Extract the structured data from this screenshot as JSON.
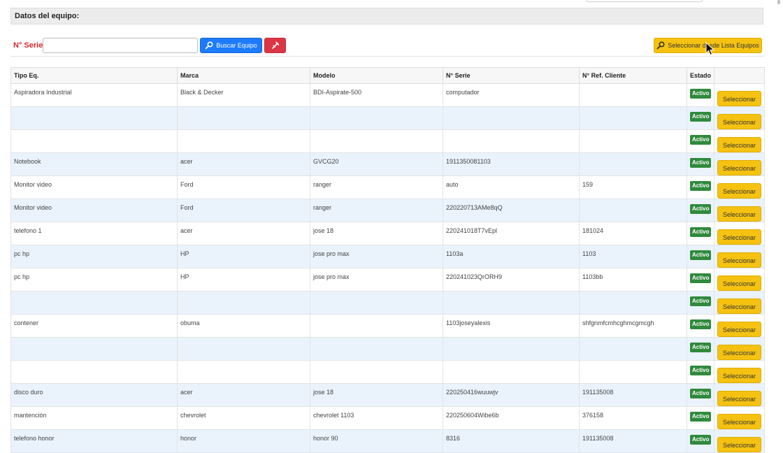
{
  "section": {
    "title": "Datos del equipo:"
  },
  "search": {
    "serial_label": "N° Serie:",
    "serial_value": "",
    "search_button": "Buscar Equipo",
    "select_from_list_button": "Seleccionar desde Lista Equipos"
  },
  "table": {
    "headers": [
      "Tipo Eq.",
      "Marca",
      "Modelo",
      "N° Serie",
      "N° Ref. Cliente",
      "Estado",
      ""
    ],
    "rows": [
      {
        "tipo": "Aspiradora Industrial",
        "marca": "Black & Decker",
        "modelo": "BDI-Aspirate-500",
        "serie": "computador",
        "ref": "",
        "estado": "Activo",
        "accion": "Seleccionar"
      },
      {
        "tipo": "",
        "marca": "",
        "modelo": "",
        "serie": "",
        "ref": "",
        "estado": "Activo",
        "accion": "Seleccionar"
      },
      {
        "tipo": "",
        "marca": "",
        "modelo": "",
        "serie": "",
        "ref": "",
        "estado": "Activo",
        "accion": "Seleccionar"
      },
      {
        "tipo": "Notebook",
        "marca": "acer",
        "modelo": "GVCG20",
        "serie": "1911350081103",
        "ref": "",
        "estado": "Activo",
        "accion": "Seleccionar"
      },
      {
        "tipo": "Monitor video",
        "marca": "Ford",
        "modelo": "ranger",
        "serie": "auto",
        "ref": "159",
        "estado": "Activo",
        "accion": "Seleccionar"
      },
      {
        "tipo": "Monitor video",
        "marca": "Ford",
        "modelo": "ranger",
        "serie": "220220713AMe8qQ",
        "ref": "",
        "estado": "Activo",
        "accion": "Seleccionar"
      },
      {
        "tipo": "telefono 1",
        "marca": "acer",
        "modelo": "jose 18",
        "serie": "220241018T7vEpl",
        "ref": "181024",
        "estado": "Activo",
        "accion": "Seleccionar"
      },
      {
        "tipo": "pc hp",
        "marca": "HP",
        "modelo": "jose pro max",
        "serie": "1103a",
        "ref": "1103",
        "estado": "Activo",
        "accion": "Seleccionar"
      },
      {
        "tipo": "pc hp",
        "marca": "HP",
        "modelo": "jose pro max",
        "serie": "220241023QrORH9",
        "ref": "1103bb",
        "estado": "Activo",
        "accion": "Seleccionar"
      },
      {
        "tipo": "",
        "marca": "",
        "modelo": "",
        "serie": "",
        "ref": "",
        "estado": "Activo",
        "accion": "Seleccionar"
      },
      {
        "tipo": "contener",
        "marca": "obuma",
        "modelo": "",
        "serie": "1103joseyalexis",
        "ref": "shfgnmfcmhcghmcgmcgh",
        "estado": "Activo",
        "accion": "Seleccionar"
      },
      {
        "tipo": "",
        "marca": "",
        "modelo": "",
        "serie": "",
        "ref": "",
        "estado": "Activo",
        "accion": "Seleccionar"
      },
      {
        "tipo": "",
        "marca": "",
        "modelo": "",
        "serie": "",
        "ref": "",
        "estado": "Activo",
        "accion": "Seleccionar"
      },
      {
        "tipo": "disco duro",
        "marca": "acer",
        "modelo": "jose 18",
        "serie": "220250416wuuwjv",
        "ref": "191135008",
        "estado": "Activo",
        "accion": "Seleccionar"
      },
      {
        "tipo": "mantención",
        "marca": "chevrolet",
        "modelo": "chevrolet 1103",
        "serie": "220250604Wibe6b",
        "ref": "376158",
        "estado": "Activo",
        "accion": "Seleccionar"
      },
      {
        "tipo": "telefono honor",
        "marca": "honor",
        "modelo": "honor 90",
        "serie": "8316",
        "ref": "191135008",
        "estado": "Activo",
        "accion": "Seleccionar"
      }
    ]
  },
  "colors": {
    "serial_label": "#d9262c",
    "search_button": "#1d7bff",
    "clear_button": "#dc3545",
    "select_button": "#f5c211",
    "active_badge": "#2f8a3c",
    "row_alt": "#eaf3fc"
  },
  "icons": {
    "search": "search-icon",
    "clear": "eraser-icon",
    "cursor": "mouse-cursor-icon"
  }
}
